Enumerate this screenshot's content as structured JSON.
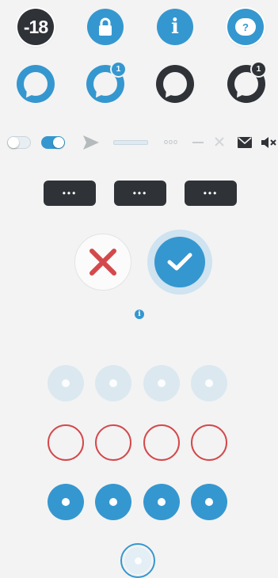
{
  "colors": {
    "accent": "#3597cf",
    "dark": "#2f3338",
    "error": "#d4484b",
    "disabled": "#dbe8f0",
    "background": "#f3f3f3"
  },
  "icons_row": {
    "age_label": "-18",
    "info_glyph": "i",
    "help_glyph": "?"
  },
  "chat_row": {
    "badge_blue_count": "1",
    "badge_dark_count": "1"
  },
  "toolbar": {
    "toggle_off_state": "off",
    "toggle_on_state": "on",
    "dots_label": "ooo"
  },
  "pills": [
    {
      "label": "•••"
    },
    {
      "label": "•••"
    },
    {
      "label": "•••"
    }
  ],
  "actions": {
    "info_glyph": "i"
  },
  "states": {
    "rows": [
      "disabled",
      "error",
      "active"
    ],
    "count_per_row": 4,
    "focused_state": "focused"
  }
}
